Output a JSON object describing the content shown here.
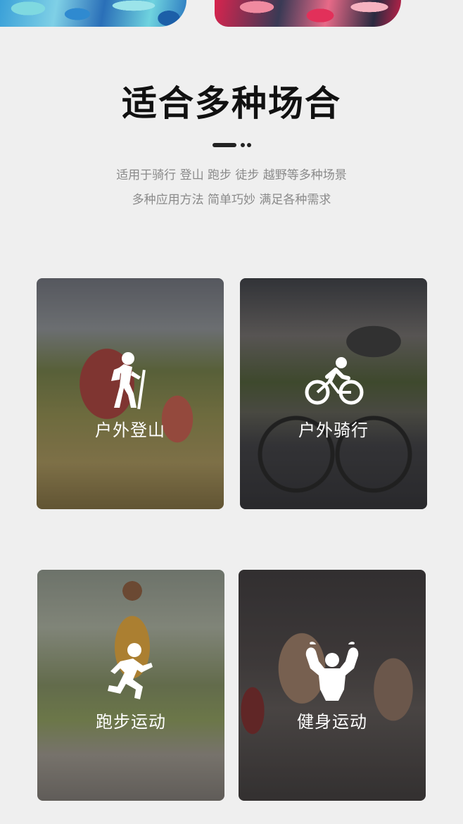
{
  "header": {
    "title": "适合多种场合",
    "subtitle_lines": [
      "适用于骑行 登山 跑步 徒步 越野等多种场景",
      "多种应用方法 简单巧妙 满足各种需求"
    ]
  },
  "cards": [
    {
      "label": "户外登山",
      "icon": "hiking-icon"
    },
    {
      "label": "户外骑行",
      "icon": "cycling-icon"
    },
    {
      "label": "跑步运动",
      "icon": "running-icon"
    },
    {
      "label": "健身运动",
      "icon": "fitness-icon"
    }
  ],
  "colors": {
    "background": "#efefef",
    "title": "#111111",
    "subtitle": "#8a8a8a",
    "card_label": "#ffffff"
  }
}
